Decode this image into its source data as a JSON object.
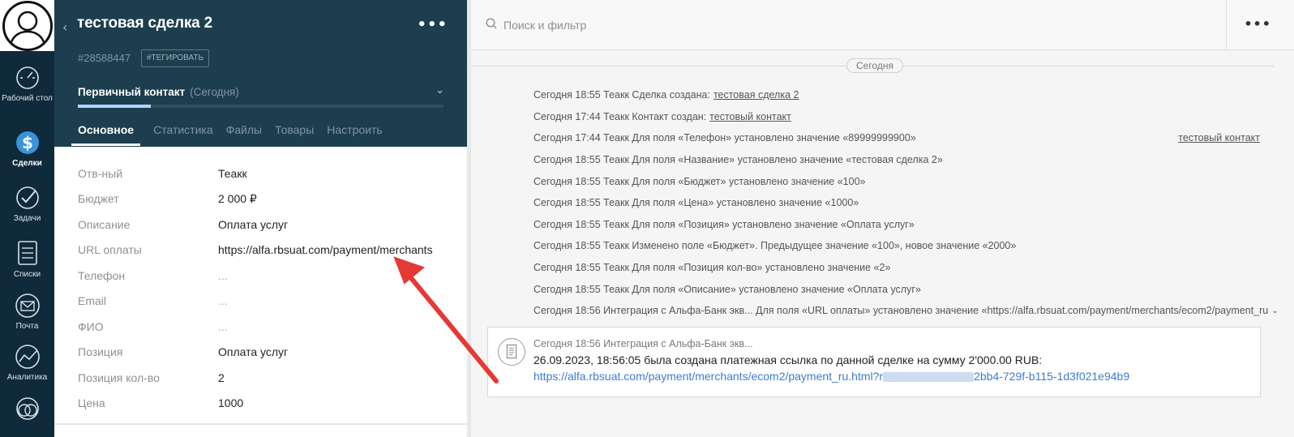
{
  "nav": {
    "items": [
      {
        "label": "Рабочий стол",
        "icon": "dashboard-icon"
      },
      {
        "label": "Сделки",
        "icon": "deals-icon"
      },
      {
        "label": "Задачи",
        "icon": "tasks-icon"
      },
      {
        "label": "Списки",
        "icon": "lists-icon"
      },
      {
        "label": "Почта",
        "icon": "mail-icon"
      },
      {
        "label": "Аналитика",
        "icon": "analytics-icon"
      }
    ]
  },
  "deal": {
    "title": "тестовая сделка 2",
    "id": "#28588447",
    "tag_label": "#ТЕГИРОВАТЬ",
    "stage": "Первичный контакт",
    "stage_date": "(Сегодня)",
    "stage_progress": 0.2
  },
  "tabs": [
    "Основное",
    "Статистика",
    "Файлы",
    "Товары",
    "Настроить"
  ],
  "fields": [
    {
      "label": "Отв-ный",
      "value": "Теакк"
    },
    {
      "label": "Бюджет",
      "value": "2 000 ₽"
    },
    {
      "label": "Описание",
      "value": "Оплата услуг"
    },
    {
      "label": "URL оплаты",
      "value": "https://alfa.rbsuat.com/payment/merchants"
    },
    {
      "label": "Телефон",
      "value": "..."
    },
    {
      "label": "Email",
      "value": "..."
    },
    {
      "label": "ФИО",
      "value": "..."
    },
    {
      "label": "Позиция",
      "value": "Оплата услуг"
    },
    {
      "label": "Позиция кол-во",
      "value": "2"
    },
    {
      "label": "Цена",
      "value": "1000"
    }
  ],
  "feed": {
    "search_placeholder": "Поиск и фильтр",
    "date_pill": "Сегодня",
    "events": [
      {
        "text": "Сегодня 18:55 Теакк Сделка создана:",
        "link": "тестовая сделка 2",
        "side": ""
      },
      {
        "text": "Сегодня 17:44 Теакк Контакт создан:",
        "link": "тестовый контакт",
        "side": ""
      },
      {
        "text": "Сегодня 17:44 Теакк Для поля «Телефон» установлено значение «89999999900»",
        "link": "",
        "side": "тестовый контакт"
      },
      {
        "text": "Сегодня 18:55 Теакк Для поля «Название» установлено значение «тестовая сделка 2»",
        "link": "",
        "side": ""
      },
      {
        "text": "Сегодня 18:55 Теакк Для поля «Бюджет» установлено значение «100»",
        "link": "",
        "side": ""
      },
      {
        "text": "Сегодня 18:55 Теакк Для поля «Цена» установлено значение «1000»",
        "link": "",
        "side": ""
      },
      {
        "text": "Сегодня 18:55 Теакк Для поля «Позиция» установлено значение «Оплата услуг»",
        "link": "",
        "side": ""
      },
      {
        "text": "Сегодня 18:55 Теакк Изменено поле «Бюджет». Предыдущее значение «100», новое значение «2000»",
        "link": "",
        "side": ""
      },
      {
        "text": "Сегодня 18:55 Теакк Для поля «Позиция кол-во» установлено значение «2»",
        "link": "",
        "side": ""
      },
      {
        "text": "Сегодня 18:55 Теакк Для поля «Описание» установлено значение «Оплата услуг»",
        "link": "",
        "side": ""
      },
      {
        "text": "Сегодня 18:56 Интеграция с Альфа-Банк экв... Для поля «URL оплаты» установлено значение «https://alfa.rbsuat.com/payment/merchants/ecom2/payment_ru",
        "link": "",
        "side": ""
      }
    ],
    "note": {
      "meta": "Сегодня 18:56 Интеграция с Альфа-Банк экв...",
      "text": "26.09.2023, 18:56:05 была создана платежная ссылка по данной сделке на сумму 2'000.00 RUB:",
      "link_start": "https://alfa.rbsuat.com/payment/merchants/ecom2/payment_ru.html?r",
      "link_end": "2bb4-729f-b115-1d3f021e94b9"
    }
  },
  "colors": {
    "card_header": "#1d3e4e",
    "rail": "#0f2a3a",
    "link": "#3d7bd0",
    "arrow": "#e53935",
    "stage_bar": "#aed6ff"
  }
}
